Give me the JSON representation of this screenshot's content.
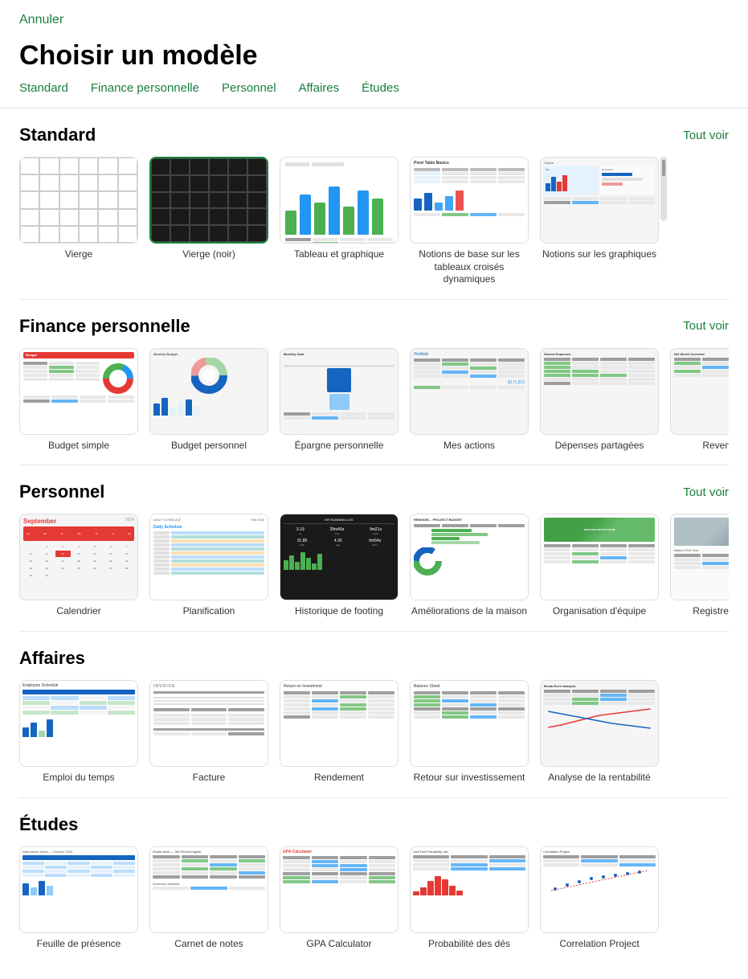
{
  "cancel_label": "Annuler",
  "page_title": "Choisir un modèle",
  "nav": {
    "items": [
      {
        "label": "Standard",
        "id": "standard"
      },
      {
        "label": "Finance personnelle",
        "id": "finance"
      },
      {
        "label": "Personnel",
        "id": "personnel"
      },
      {
        "label": "Affaires",
        "id": "affaires"
      },
      {
        "label": "Études",
        "id": "etudes"
      }
    ]
  },
  "sections": {
    "standard": {
      "title": "Standard",
      "see_all": "Tout voir",
      "templates": [
        {
          "id": "vierge",
          "label": "Vierge",
          "type": "blank-white"
        },
        {
          "id": "vierge-noir",
          "label": "Vierge (noir)",
          "type": "blank-dark",
          "selected": true
        },
        {
          "id": "tableau-graphique",
          "label": "Tableau et graphique",
          "type": "chart"
        },
        {
          "id": "pivot-basics",
          "label": "Notions de base sur les tableaux croisés dynamiques",
          "type": "pivot"
        },
        {
          "id": "graph-basics",
          "label": "Notions sur les graphiques",
          "type": "graph-basics"
        }
      ]
    },
    "finance_personnelle": {
      "title": "Finance personnelle",
      "see_all": "Tout voir",
      "templates": [
        {
          "id": "budget-simple",
          "label": "Budget simple",
          "type": "budget-simple"
        },
        {
          "id": "budget-perso",
          "label": "Budget personnel",
          "type": "budget-perso"
        },
        {
          "id": "epargne",
          "label": "Épargne personnelle",
          "type": "epargne"
        },
        {
          "id": "actions",
          "label": "Mes actions",
          "type": "actions"
        },
        {
          "id": "depenses",
          "label": "Dépenses partagées",
          "type": "depenses"
        },
        {
          "id": "revenus",
          "label": "Revenus n...",
          "type": "revenus"
        }
      ]
    },
    "personnel": {
      "title": "Personnel",
      "see_all": "Tout voir",
      "templates": [
        {
          "id": "calendrier",
          "label": "Calendrier",
          "type": "calendrier"
        },
        {
          "id": "planification",
          "label": "Planification",
          "type": "planification"
        },
        {
          "id": "footing",
          "label": "Historique de footing",
          "type": "footing"
        },
        {
          "id": "maison",
          "label": "Améliorations de la maison",
          "type": "maison"
        },
        {
          "id": "equipe",
          "label": "Organisation d'équipe",
          "type": "equipe"
        },
        {
          "id": "bebe",
          "label": "Registre de bébé",
          "type": "bebe"
        }
      ]
    },
    "affaires": {
      "title": "Affaires",
      "see_all": null,
      "templates": [
        {
          "id": "emploi-temps",
          "label": "Emploi du temps",
          "type": "emploi-temps"
        },
        {
          "id": "facture",
          "label": "Facture",
          "type": "facture"
        },
        {
          "id": "rendement",
          "label": "Rendement",
          "type": "rendement"
        },
        {
          "id": "retour-invest",
          "label": "Retour sur investissement",
          "type": "retour-invest"
        },
        {
          "id": "rentabilite",
          "label": "Analyse de la rentabilité",
          "type": "rentabilite"
        }
      ]
    },
    "etudes": {
      "title": "Études",
      "see_all": null,
      "templates": [
        {
          "id": "attendance",
          "label": "Feuille de présence",
          "type": "attendance"
        },
        {
          "id": "grade-book",
          "label": "Carnet de notes",
          "type": "grade-book"
        },
        {
          "id": "gpa-calc",
          "label": "GPA Calculator",
          "type": "gpa-calc"
        },
        {
          "id": "dice-prob",
          "label": "Probabilité des dés",
          "type": "dice-prob"
        },
        {
          "id": "correlation",
          "label": "Correlation Project",
          "type": "correlation"
        }
      ]
    }
  }
}
